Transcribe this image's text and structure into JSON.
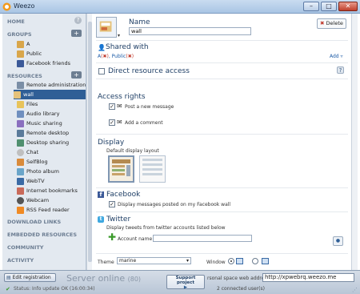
{
  "window": {
    "title": "Weezo"
  },
  "sidebar": {
    "home_label": "HOME",
    "groups_label": "GROUPS",
    "groups": [
      {
        "label": "A",
        "icon": "user-icon"
      },
      {
        "label": "Public",
        "icon": "user-icon"
      },
      {
        "label": "Facebook friends",
        "icon": "facebook-icon"
      }
    ],
    "resources_label": "RESOURCES",
    "resources": [
      {
        "label": "Remote administration",
        "icon": "admin-icon"
      },
      {
        "label": "wall",
        "icon": "wall-icon"
      },
      {
        "label": "Files",
        "icon": "folder-icon"
      },
      {
        "label": "Audio library",
        "icon": "audio-icon"
      },
      {
        "label": "Music sharing",
        "icon": "music-icon"
      },
      {
        "label": "Remote desktop",
        "icon": "desktop-icon"
      },
      {
        "label": "Desktop sharing",
        "icon": "desktop-share-icon"
      },
      {
        "label": "Chat",
        "icon": "chat-icon"
      },
      {
        "label": "SelfBlog",
        "icon": "blog-icon"
      },
      {
        "label": "Photo album",
        "icon": "photo-icon"
      },
      {
        "label": "WebTV",
        "icon": "tv-icon"
      },
      {
        "label": "Internet bookmarks",
        "icon": "bookmark-icon"
      },
      {
        "label": "Webcam",
        "icon": "webcam-icon"
      },
      {
        "label": "RSS Feed reader",
        "icon": "rss-icon"
      }
    ],
    "download_links_label": "DOWNLOAD LINKS",
    "embedded_label": "EMBEDDED RESOURCES",
    "community_label": "COMMUNITY",
    "activity_label": "ACTIVITY"
  },
  "main": {
    "name_label": "Name",
    "name_value": "wall",
    "delete_label": "Delete",
    "shared_with_label": "Shared with",
    "shared_a": "A",
    "shared_public": "Public",
    "add_label": "Add",
    "direct_access_label": "Direct resource access",
    "access_rights_label": "Access rights",
    "post_new_message": "Post a new message",
    "add_comment": "Add a comment",
    "display_label": "Display",
    "default_layout_label": "Default display layout",
    "facebook_label": "Facebook",
    "facebook_option": "Display messages posted on my Facebook wall",
    "twitter_label": "Twitter",
    "twitter_desc": "Display tweets from twitter accounts listed below",
    "account_name_label": "Account name",
    "theme_label": "Theme",
    "theme_value": "marine",
    "window_label": "Window"
  },
  "bottom": {
    "edit_registration": "Edit registration",
    "status": "Status: Info update OK (16:00:34)",
    "server_online": "Server online",
    "server_count": "(80)",
    "support_project": "Support project",
    "web_address_label": "rsonal space web address",
    "web_address": "http://xpwebrq.weezo.me",
    "connected": "2 connected user(s)"
  },
  "colors": {
    "sidebar_bg": "#e3e9f0",
    "selected": "#2f5f96",
    "section_title": "#1f3f66"
  }
}
